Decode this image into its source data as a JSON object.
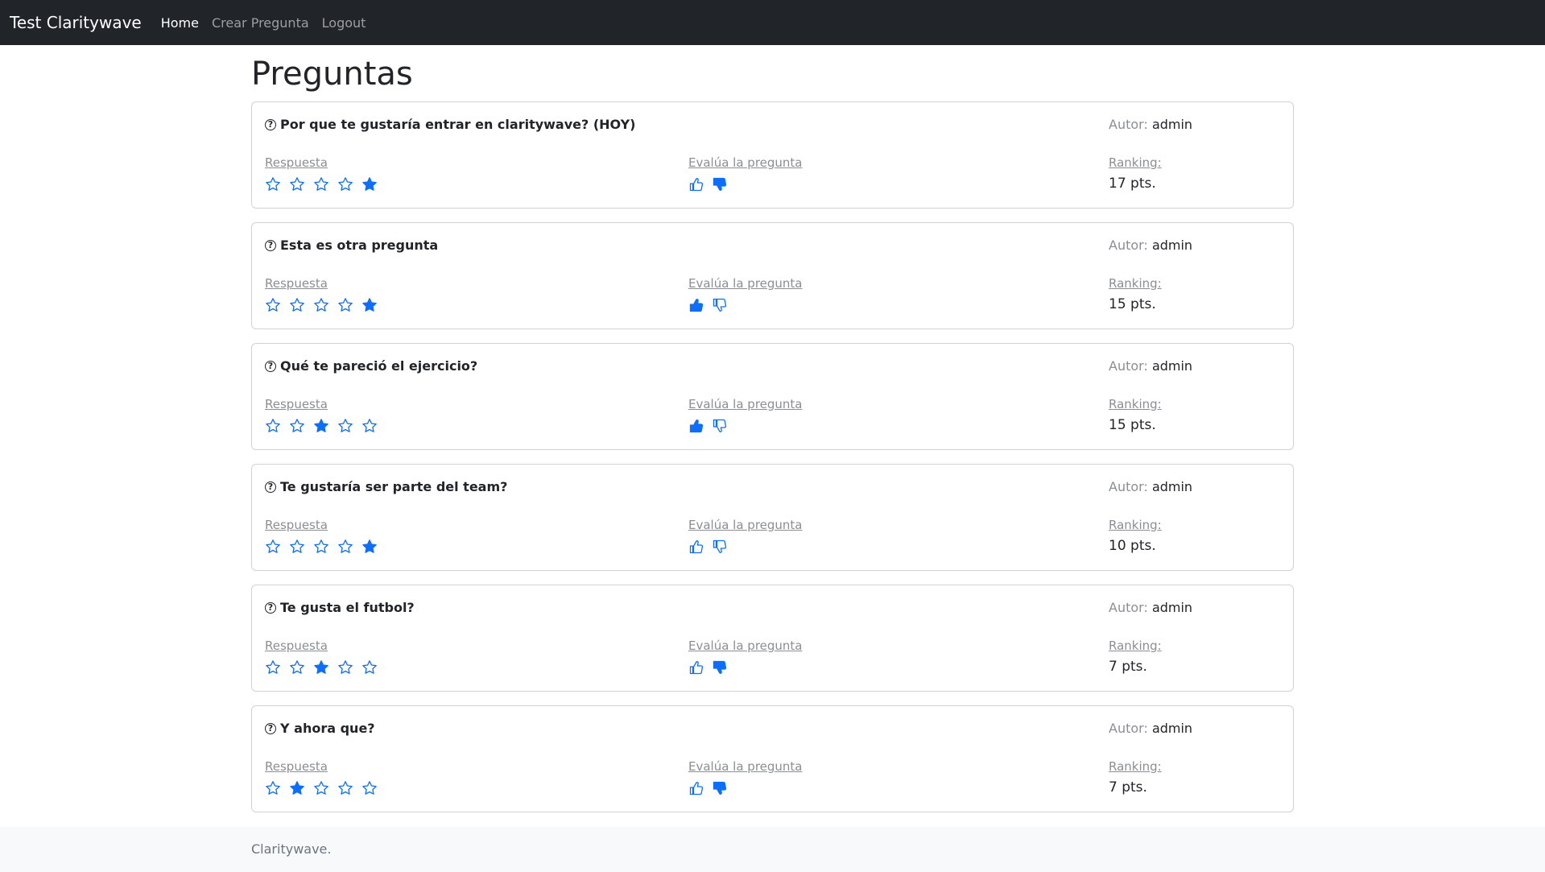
{
  "navbar": {
    "brand": "Test Claritywave",
    "links": [
      "Home",
      "Crear Pregunta",
      "Logout"
    ]
  },
  "page": {
    "title": "Preguntas"
  },
  "labels": {
    "author": "Autor:",
    "answer": "Respuesta",
    "evaluate": "Evalúa la pregunta",
    "ranking": "Ranking:"
  },
  "questions": [
    {
      "title": "Por que te gustaría entrar en claritywave? (HOY)",
      "author": "admin",
      "rating": 5,
      "vote": "down",
      "ranking": "17 pts."
    },
    {
      "title": "Esta es otra pregunta",
      "author": "admin",
      "rating": 5,
      "vote": "up",
      "ranking": "15 pts."
    },
    {
      "title": "Qué te pareció el ejercicio?",
      "author": "admin",
      "rating": 3,
      "vote": "up",
      "ranking": "15 pts."
    },
    {
      "title": "Te gustaría ser parte del team?",
      "author": "admin",
      "rating": 5,
      "vote": "none",
      "ranking": "10 pts."
    },
    {
      "title": "Te gusta el futbol?",
      "author": "admin",
      "rating": 3,
      "vote": "down",
      "ranking": "7 pts."
    },
    {
      "title": "Y ahora que?",
      "author": "admin",
      "rating": 2,
      "vote": "down",
      "ranking": "7 pts."
    }
  ],
  "footer": {
    "text": "Claritywave."
  },
  "colors": {
    "accent": "#0d6efd",
    "navbar": "#212529"
  },
  "icons": {
    "question": "question-circle-icon",
    "star": "star-icon",
    "thumbs_up": "thumbs-up-icon",
    "thumbs_down": "thumbs-down-icon"
  }
}
